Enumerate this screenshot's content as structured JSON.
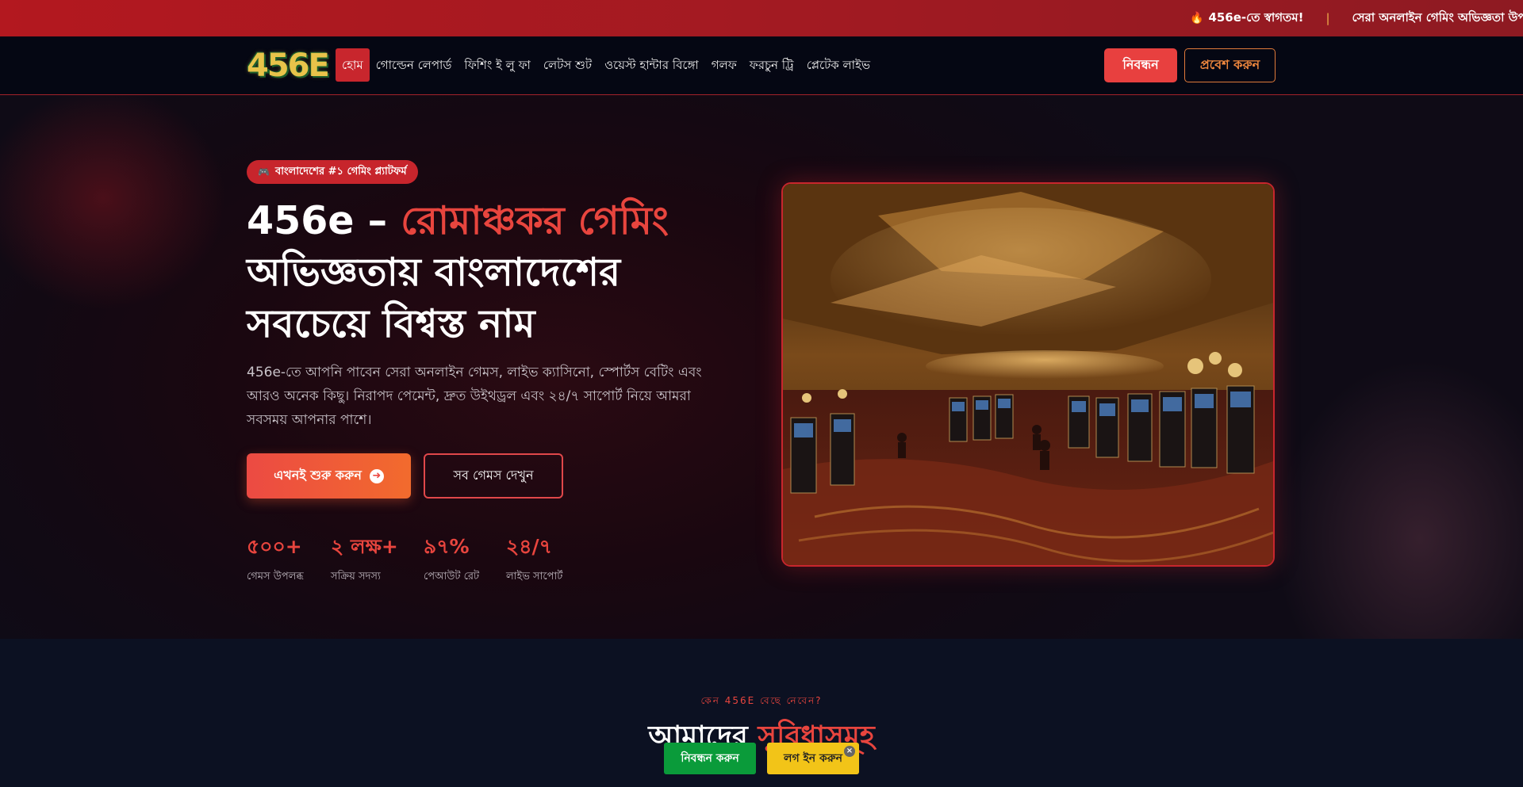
{
  "ticker": {
    "fire_icon": "fire-icon",
    "welcome": "456e-তে স্বাগতম!",
    "separator": "|",
    "message": "সেরা অনলাইন গেমিং অভিজ্ঞতা উপভো"
  },
  "header": {
    "logo": "456E",
    "nav": [
      "হোম",
      "গোল্ডেন লেপার্ড",
      "ফিশিং ই লু ফা",
      "লেটস শুট",
      "ওয়েস্ট হান্টার বিঙ্গো",
      "গলফ",
      "ফরচুন ট্রি",
      "প্লেটেক লাইভ"
    ],
    "register_label": "নিবন্ধন",
    "login_label": "প্রবেশ করুন"
  },
  "hero": {
    "badge_icon": "gamepad-icon",
    "badge": "বাংলাদেশের #১ গেমিং প্ল্যাটফর্ম",
    "title_prefix": "456e – ",
    "title_accent": "রোমাঞ্চকর গেমিং",
    "title_rest": "অভিজ্ঞতায় বাংলাদেশের সবচেয়ে বিশ্বস্ত নাম",
    "description": "456e-তে আপনি পাবেন সেরা অনলাইন গেমস, লাইভ ক্যাসিনো, স্পোর্টস বেটিং এবং আরও অনেক কিছু। নিরাপদ পেমেন্ট, দ্রুত উইথড্রল এবং ২৪/৭ সাপোর্ট নিয়ে আমরা সবসময় আপনার পাশে।",
    "cta_primary": "এখনই শুরু করুন",
    "cta_secondary": "সব গেমস দেখুন",
    "stats": [
      {
        "value": "৫০০+",
        "label": "গেমস উপলব্ধ"
      },
      {
        "value": "২ লক্ষ+",
        "label": "সক্রিয় সদস্য"
      },
      {
        "value": "৯৭%",
        "label": "পেআউট রেট"
      },
      {
        "value": "২৪/৭",
        "label": "লাইভ সাপোর্ট"
      }
    ]
  },
  "features": {
    "kicker": "কেন 456E বেছে নেবেন?",
    "title_prefix": "আমাদের ",
    "title_accent": "সুবিধাসমূহ"
  },
  "floating_bar": {
    "register": "নিবন্ধন করুন",
    "login": "লগ ইন করুন",
    "close": "×"
  },
  "colors": {
    "accent": "#e8453e",
    "ticker_bg": "#b3181f",
    "header_bg": "#050713",
    "float_register": "#0a9b3a",
    "float_login": "#f2c418"
  }
}
